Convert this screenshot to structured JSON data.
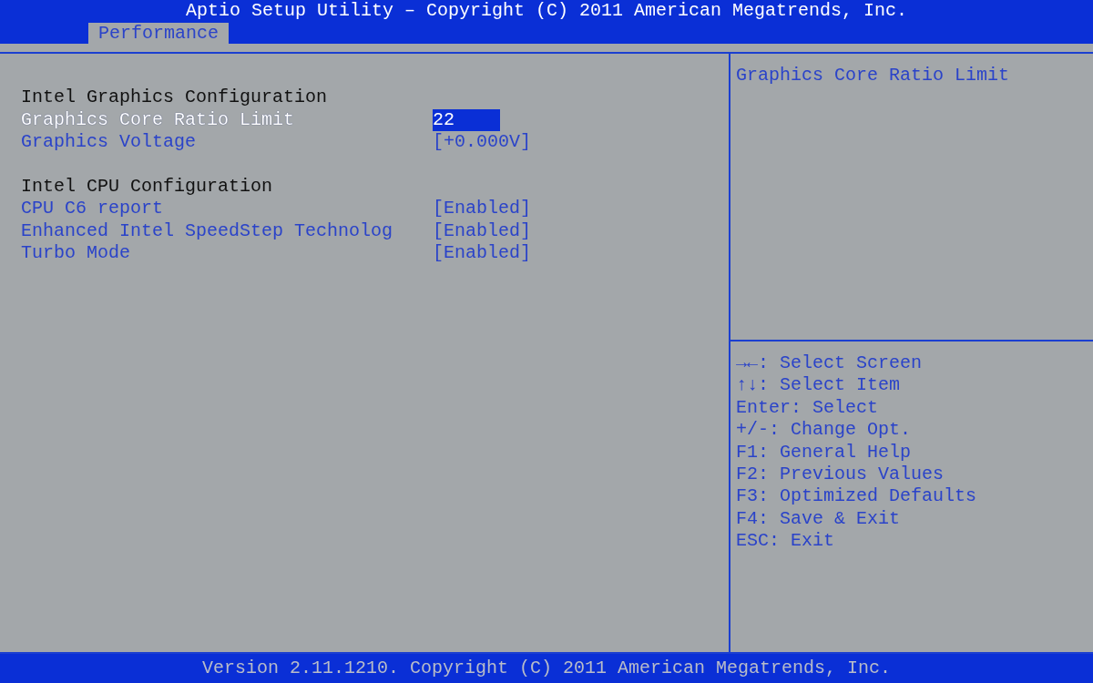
{
  "window": {
    "title": "Aptio Setup Utility – Copyright (C) 2011 American Megatrends, Inc."
  },
  "tabs": [
    {
      "label": "Performance",
      "selected": true
    }
  ],
  "sections": [
    {
      "heading": "Intel Graphics Configuration",
      "items": [
        {
          "label": "Graphics Core Ratio Limit",
          "value": "22",
          "selected": true
        },
        {
          "label": "Graphics Voltage",
          "value": "[+0.000V]",
          "selected": false
        }
      ]
    },
    {
      "heading": "Intel CPU Configuration",
      "items": [
        {
          "label": "CPU C6 report",
          "value": "[Enabled]",
          "selected": false
        },
        {
          "label": "Enhanced Intel SpeedStep Technolog",
          "value": "[Enabled]",
          "selected": false
        },
        {
          "label": "Turbo Mode",
          "value": "[Enabled]",
          "selected": false
        }
      ]
    }
  ],
  "help_text": "Graphics Core Ratio Limit",
  "key_help": [
    "→←: Select Screen",
    "↑↓: Select Item",
    "Enter: Select",
    "+/-: Change Opt.",
    "F1: General Help",
    "F2: Previous Values",
    "F3: Optimized Defaults",
    "F4: Save & Exit",
    "ESC: Exit"
  ],
  "status_bar": "Version 2.11.1210. Copyright (C) 2011 American Megatrends, Inc."
}
